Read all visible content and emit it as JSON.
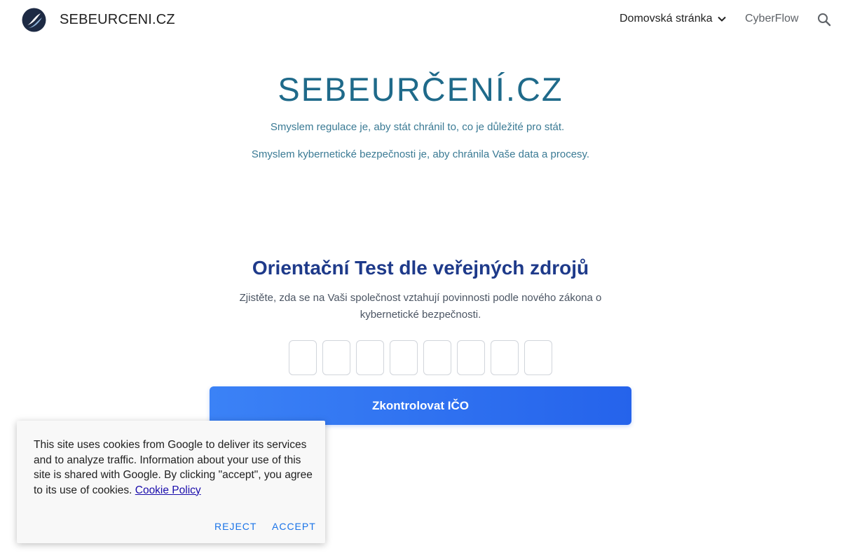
{
  "header": {
    "site_name": "SEBEURCENI.CZ",
    "nav": {
      "home_label": "Domovská stránka",
      "cyberflow_label": "CyberFlow"
    },
    "icons": {
      "logo": "logo-icon",
      "chevron": "chevron-down-icon",
      "search": "search-icon"
    }
  },
  "hero": {
    "title": "SEBEURČENÍ.CZ",
    "line1": "Smyslem regulace je, aby stát chránil to, co je důležité pro stát.",
    "line2": "Smyslem kybernetické bezpečnosti je, aby chránila Vaše data a procesy."
  },
  "test": {
    "title": "Orientační Test dle veřejných zdrojů",
    "description": "Zjistěte, zda se na Vaši společnost vztahují povinnosti podle nového zákona o kybernetické bezpečnosti.",
    "digits": [
      "",
      "",
      "",
      "",
      "",
      "",
      "",
      ""
    ],
    "button_label": "Zkontrolovat IČO"
  },
  "cookie": {
    "text": "This site uses cookies from Google to deliver its services and to analyze traffic. Information about your use of this site is shared with Google. By clicking \"accept\", you agree to its use of cookies.",
    "link_label": "Cookie Policy",
    "reject_label": "REJECT",
    "accept_label": "ACCEPT"
  },
  "colors": {
    "hero_title": "#1f6a8a",
    "test_title": "#1e3a8a",
    "button": "#2563eb",
    "cookie_action": "#1a73e8"
  }
}
